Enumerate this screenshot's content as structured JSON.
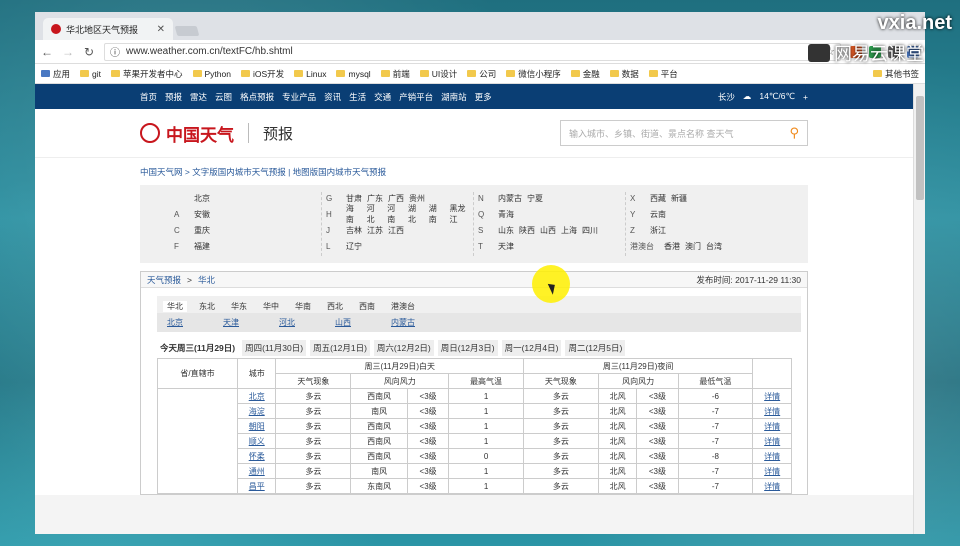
{
  "browser": {
    "tab_title": "华北地区天气预报",
    "url": "www.weather.com.cn/textFC/hb.shtml"
  },
  "bookmarks": [
    "应用",
    "git",
    "苹果开发者中心",
    "Python",
    "iOS开发",
    "Linux",
    "mysql",
    "前端",
    "UI设计",
    "公司",
    "微信小程序",
    "金融",
    "数据",
    "平台",
    "其他书签"
  ],
  "nav": {
    "items": [
      "首页",
      "预报",
      "雷达",
      "云图",
      "格点预报",
      "专业产品",
      "资讯",
      "生活",
      "交通",
      "产销平台",
      "湖南站",
      "更多"
    ],
    "city": "长沙",
    "weather": "14℃/6℃",
    "add": "+"
  },
  "header": {
    "logo": "中国天气",
    "logo_seal": "中国天气",
    "sub": "预报",
    "search_placeholder": "输入城市、乡镇、街道、景点名称 查天气"
  },
  "breadcrumb": {
    "a": "中国天气网",
    "b": " > 文字版国内城市天气预报 | ",
    "c": "地图版国内城市天气预报"
  },
  "regions": [
    [
      {
        "l": "",
        "p": [
          "北京"
        ]
      },
      {
        "l": "A",
        "p": [
          "安徽"
        ]
      },
      {
        "l": "C",
        "p": [
          "重庆"
        ]
      },
      {
        "l": "F",
        "p": [
          "福建"
        ]
      }
    ],
    [
      {
        "l": "G",
        "p": [
          "甘肃",
          "广东",
          "广西",
          "贵州"
        ]
      },
      {
        "l": "H",
        "p": [
          "海南",
          "河北",
          "河南",
          "湖北",
          "湖南",
          "黑龙江"
        ]
      },
      {
        "l": "J",
        "p": [
          "吉林",
          "江苏",
          "江西"
        ]
      },
      {
        "l": "L",
        "p": [
          "辽宁"
        ]
      }
    ],
    [
      {
        "l": "N",
        "p": [
          "内蒙古",
          "宁夏"
        ]
      },
      {
        "l": "Q",
        "p": [
          "青海"
        ]
      },
      {
        "l": "S",
        "p": [
          "山东",
          "陕西",
          "山西",
          "上海",
          "四川"
        ]
      },
      {
        "l": "T",
        "p": [
          "天津"
        ]
      }
    ],
    [
      {
        "l": "X",
        "p": [
          "西藏",
          "新疆"
        ]
      },
      {
        "l": "Y",
        "p": [
          "云南"
        ]
      },
      {
        "l": "Z",
        "p": [
          "浙江"
        ]
      },
      {
        "l": "港澳台",
        "p": [
          "香港",
          "澳门",
          "台湾"
        ]
      }
    ]
  ],
  "panel": {
    "title": "天气预报",
    "sep": ">",
    "region": "华北",
    "publish": "发布时间: 2017-11-29 11:30"
  },
  "area_tabs": [
    "华北",
    "东北",
    "华东",
    "华中",
    "华南",
    "西北",
    "西南",
    "港澳台"
  ],
  "province_links": [
    "北京",
    "天津",
    "河北",
    "山西",
    "内蒙古"
  ],
  "days": [
    "今天周三(11月29日)",
    "周四(11月30日)",
    "周五(12月1日)",
    "周六(12月2日)",
    "周日(12月3日)",
    "周一(12月4日)",
    "周二(12月5日)"
  ],
  "table": {
    "h_prov": "省/直辖市",
    "h_city": "城市",
    "h_day": "周三(11月29日)白天",
    "h_night": "周三(11月29日)夜间",
    "h_wea": "天气现象",
    "h_wind": "风向风力",
    "h_max": "最高气温",
    "h_min": "最低气温",
    "rows": [
      [
        "北京",
        "多云",
        "西南风",
        "<3级",
        "1",
        "多云",
        "北风",
        "<3级",
        "-6",
        "详情"
      ],
      [
        "海淀",
        "多云",
        "南风",
        "<3级",
        "1",
        "多云",
        "北风",
        "<3级",
        "-7",
        "详情"
      ],
      [
        "朝阳",
        "多云",
        "西南风",
        "<3级",
        "1",
        "多云",
        "北风",
        "<3级",
        "-7",
        "详情"
      ],
      [
        "顺义",
        "多云",
        "西南风",
        "<3级",
        "1",
        "多云",
        "北风",
        "<3级",
        "-7",
        "详情"
      ],
      [
        "怀柔",
        "多云",
        "西南风",
        "<3级",
        "0",
        "多云",
        "北风",
        "<3级",
        "-8",
        "详情"
      ],
      [
        "通州",
        "多云",
        "南风",
        "<3级",
        "1",
        "多云",
        "北风",
        "<3级",
        "-7",
        "详情"
      ],
      [
        "昌平",
        "多云",
        "东南风",
        "<3级",
        "1",
        "多云",
        "北风",
        "<3级",
        "-7",
        "详情"
      ]
    ]
  },
  "watermark": {
    "site": "vxia.net",
    "brand": "网易云课堂"
  }
}
